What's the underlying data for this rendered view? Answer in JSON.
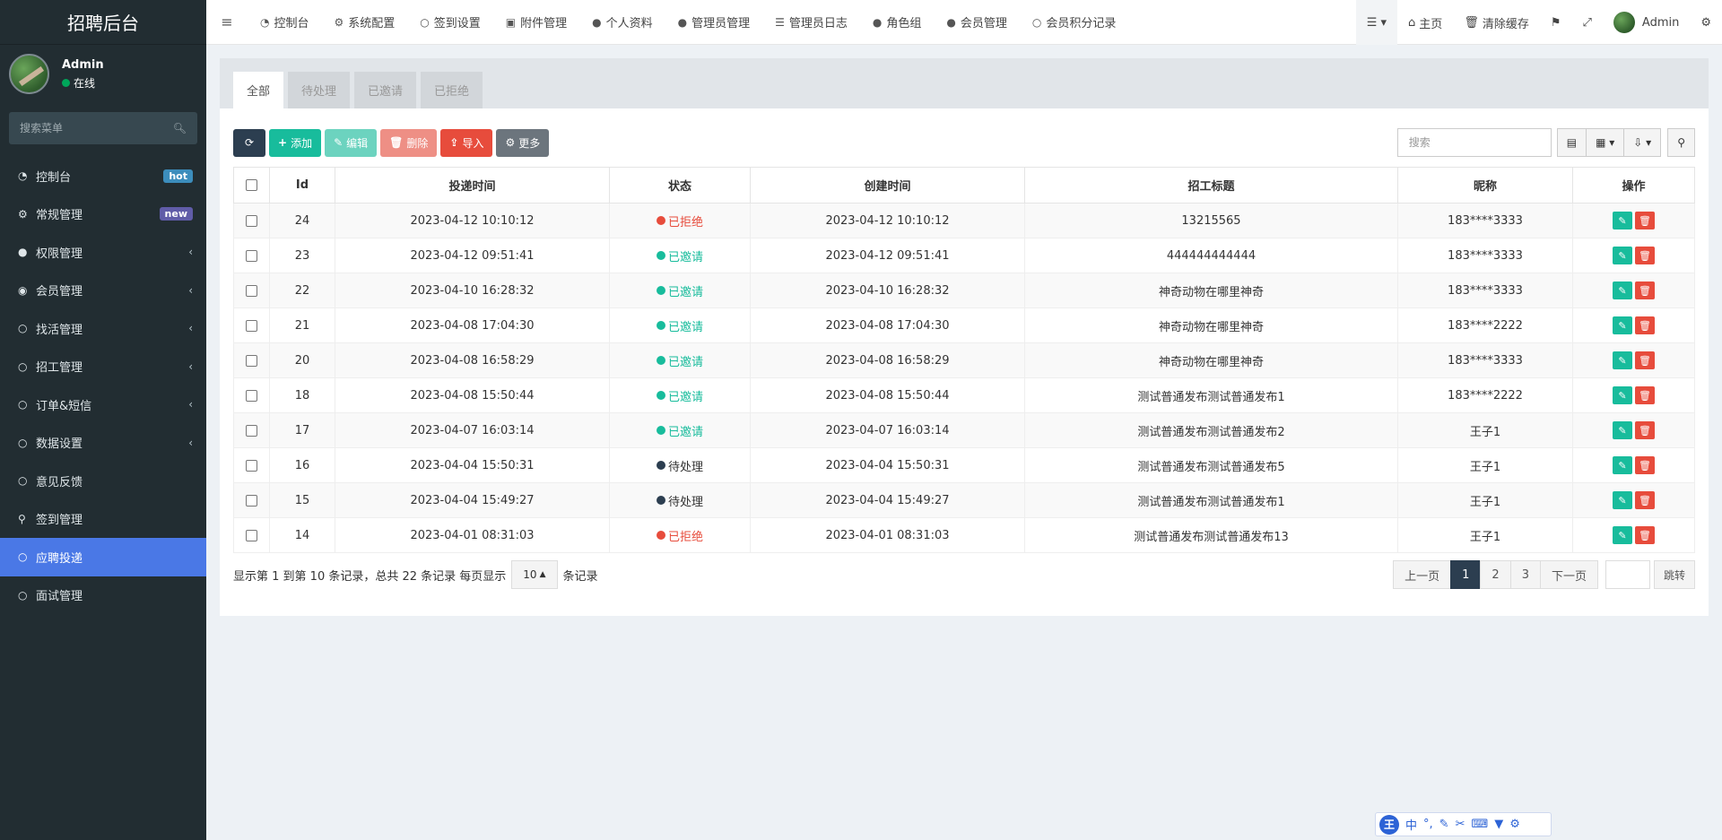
{
  "sidebar": {
    "brand": "招聘后台",
    "user": {
      "name": "Admin",
      "status": "在线"
    },
    "search_placeholder": "搜索菜单",
    "items": [
      {
        "label": "控制台",
        "icon": "dashboard-icon",
        "badge": "hot"
      },
      {
        "label": "常规管理",
        "icon": "cogs-icon",
        "badge": "new"
      },
      {
        "label": "权限管理",
        "icon": "group-icon",
        "expandable": true
      },
      {
        "label": "会员管理",
        "icon": "user-circle-icon",
        "expandable": true
      },
      {
        "label": "找活管理",
        "icon": "circle-icon",
        "expandable": true
      },
      {
        "label": "招工管理",
        "icon": "circle-icon",
        "expandable": true
      },
      {
        "label": "订单&短信",
        "icon": "circle-icon",
        "expandable": true
      },
      {
        "label": "数据设置",
        "icon": "circle-icon",
        "expandable": true
      },
      {
        "label": "意见反馈",
        "icon": "circle-icon"
      },
      {
        "label": "签到管理",
        "icon": "map-marker-icon"
      },
      {
        "label": "应聘投递",
        "icon": "circle-icon",
        "active": true
      },
      {
        "label": "面试管理",
        "icon": "circle-icon"
      }
    ]
  },
  "topnav": {
    "tabs": [
      {
        "label": "控制台",
        "icon": "dashboard-icon"
      },
      {
        "label": "系统配置",
        "icon": "cog-icon"
      },
      {
        "label": "签到设置",
        "icon": "circle-icon"
      },
      {
        "label": "附件管理",
        "icon": "file-image-icon"
      },
      {
        "label": "个人资料",
        "icon": "user-icon"
      },
      {
        "label": "管理员管理",
        "icon": "user-icon"
      },
      {
        "label": "管理员日志",
        "icon": "list-alt-icon"
      },
      {
        "label": "角色组",
        "icon": "group-icon"
      },
      {
        "label": "会员管理",
        "icon": "user-icon"
      },
      {
        "label": "会员积分记录",
        "icon": "circle-icon"
      }
    ],
    "right": {
      "home": "主页",
      "clear_cache": "清除缓存",
      "admin": "Admin"
    }
  },
  "content": {
    "filter_tabs": [
      "全部",
      "待处理",
      "已邀请",
      "已拒绝"
    ],
    "toolbar": {
      "add": "添加",
      "edit": "编辑",
      "delete": "删除",
      "import": "导入",
      "more": "更多",
      "search_placeholder": "搜索"
    },
    "table": {
      "headers": [
        "Id",
        "投递时间",
        "状态",
        "创建时间",
        "招工标题",
        "昵称",
        "操作"
      ],
      "rows": [
        {
          "id": "24",
          "deliver_time": "2023-04-12 10:10:12",
          "status": "已拒绝",
          "status_color": "#e74c3c",
          "create_time": "2023-04-12 10:10:12",
          "title": "13215565",
          "nickname": "183****3333"
        },
        {
          "id": "23",
          "deliver_time": "2023-04-12 09:51:41",
          "status": "已邀请",
          "status_color": "#18bc9c",
          "create_time": "2023-04-12 09:51:41",
          "title": "444444444444",
          "nickname": "183****3333"
        },
        {
          "id": "22",
          "deliver_time": "2023-04-10 16:28:32",
          "status": "已邀请",
          "status_color": "#18bc9c",
          "create_time": "2023-04-10 16:28:32",
          "title": "神奇动物在哪里神奇",
          "nickname": "183****3333"
        },
        {
          "id": "21",
          "deliver_time": "2023-04-08 17:04:30",
          "status": "已邀请",
          "status_color": "#18bc9c",
          "create_time": "2023-04-08 17:04:30",
          "title": "神奇动物在哪里神奇",
          "nickname": "183****2222"
        },
        {
          "id": "20",
          "deliver_time": "2023-04-08 16:58:29",
          "status": "已邀请",
          "status_color": "#18bc9c",
          "create_time": "2023-04-08 16:58:29",
          "title": "神奇动物在哪里神奇",
          "nickname": "183****3333"
        },
        {
          "id": "18",
          "deliver_time": "2023-04-08 15:50:44",
          "status": "已邀请",
          "status_color": "#18bc9c",
          "create_time": "2023-04-08 15:50:44",
          "title": "测试普通发布测试普通发布1",
          "nickname": "183****2222"
        },
        {
          "id": "17",
          "deliver_time": "2023-04-07 16:03:14",
          "status": "已邀请",
          "status_color": "#18bc9c",
          "create_time": "2023-04-07 16:03:14",
          "title": "测试普通发布测试普通发布2",
          "nickname": "王子1"
        },
        {
          "id": "16",
          "deliver_time": "2023-04-04 15:50:31",
          "status": "待处理",
          "status_color": "#2c3e50",
          "create_time": "2023-04-04 15:50:31",
          "title": "测试普通发布测试普通发布5",
          "nickname": "王子1"
        },
        {
          "id": "15",
          "deliver_time": "2023-04-04 15:49:27",
          "status": "待处理",
          "status_color": "#2c3e50",
          "create_time": "2023-04-04 15:49:27",
          "title": "测试普通发布测试普通发布1",
          "nickname": "王子1"
        },
        {
          "id": "14",
          "deliver_time": "2023-04-01 08:31:03",
          "status": "已拒绝",
          "status_color": "#e74c3c",
          "create_time": "2023-04-01 08:31:03",
          "title": "测试普通发布测试普通发布13",
          "nickname": "王子1"
        }
      ]
    },
    "pagination": {
      "summary": "显示第 1 到第 10 条记录，总共 22 条记录 每页显示",
      "page_size": "10",
      "suffix": "条记录",
      "prev": "上一页",
      "pages": [
        "1",
        "2",
        "3"
      ],
      "current_page": "1",
      "next": "下一页",
      "jump": "跳转"
    }
  },
  "ime": {
    "logo": "王",
    "mode": "中"
  }
}
